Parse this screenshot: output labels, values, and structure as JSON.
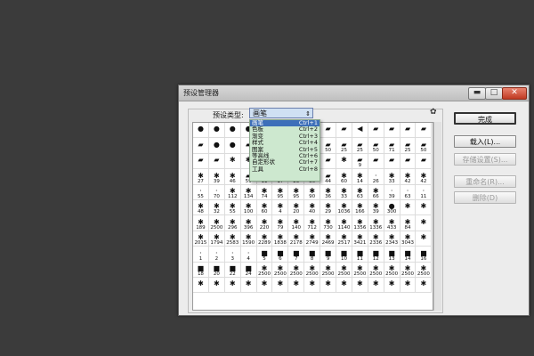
{
  "window": {
    "title": "预设管理器",
    "min": "▬",
    "max": "□",
    "close": "✕"
  },
  "preset_type_label": "预设类型:",
  "preset_type_value": "画笔",
  "dropdown_arrow": "⇕",
  "settings_icon": "gear-icon",
  "menu": [
    {
      "label": "画笔",
      "shortcut": "Ctrl+1"
    },
    {
      "label": "色板",
      "shortcut": "Ctrl+2"
    },
    {
      "label": "渐变",
      "shortcut": "Ctrl+3"
    },
    {
      "label": "样式",
      "shortcut": "Ctrl+4"
    },
    {
      "label": "图案",
      "shortcut": "Ctrl+5"
    },
    {
      "label": "等高线",
      "shortcut": "Ctrl+6"
    },
    {
      "label": "自定形状",
      "shortcut": "Ctrl+7"
    },
    {
      "label": "工具",
      "shortcut": "Ctrl+8"
    }
  ],
  "buttons": {
    "done": "完成",
    "load": "载入(L)...",
    "save": "存储设置(S)...",
    "rename": "重命名(R)...",
    "delete": "删除(D)"
  },
  "brush_rows": [
    [
      {
        "n": "",
        "g": "●"
      },
      {
        "n": "",
        "g": "●"
      },
      {
        "n": "",
        "g": "●"
      },
      {
        "n": "",
        "g": "●"
      },
      {
        "n": "",
        "g": "▰"
      },
      {
        "n": "",
        "g": "▰"
      },
      {
        "n": "",
        "g": "▰"
      },
      {
        "n": "",
        "g": "▰"
      },
      {
        "n": "",
        "g": "▰"
      },
      {
        "n": "",
        "g": "▰"
      },
      {
        "n": "",
        "g": "◀"
      },
      {
        "n": "",
        "g": "▰"
      },
      {
        "n": "",
        "g": "▰"
      },
      {
        "n": "",
        "g": "▰"
      },
      {
        "n": "",
        "g": "▰"
      }
    ],
    [
      {
        "n": "",
        "g": "▰"
      },
      {
        "n": "",
        "g": "●"
      },
      {
        "n": "",
        "g": "●"
      },
      {
        "n": "",
        "g": "▰"
      },
      {
        "n": "",
        "g": "▰"
      },
      {
        "n": "",
        "g": "▰"
      },
      {
        "n": "",
        "g": "▰"
      },
      {
        "n": "25",
        "g": "▰"
      },
      {
        "n": "50",
        "g": "▰"
      },
      {
        "n": "25",
        "g": "▰"
      },
      {
        "n": "25",
        "g": "▰"
      },
      {
        "n": "50",
        "g": "▰"
      },
      {
        "n": "71",
        "g": "▰"
      },
      {
        "n": "25",
        "g": "▰"
      },
      {
        "n": "50",
        "g": "▰"
      }
    ],
    [
      {
        "n": "",
        "g": "▰"
      },
      {
        "n": "",
        "g": "▰"
      },
      {
        "n": "",
        "g": "✱"
      },
      {
        "n": "",
        "g": "✱"
      },
      {
        "n": "",
        "g": "▰"
      },
      {
        "n": "",
        "g": "▰"
      },
      {
        "n": "",
        "g": "▰"
      },
      {
        "n": "",
        "g": "✱"
      },
      {
        "n": "",
        "g": "▰"
      },
      {
        "n": "",
        "g": "✱"
      },
      {
        "n": "9",
        "g": "▰"
      },
      {
        "n": "",
        "g": "▰"
      },
      {
        "n": "",
        "g": "▰"
      },
      {
        "n": "",
        "g": "▰"
      },
      {
        "n": "",
        "g": "▰"
      }
    ],
    [
      {
        "n": "27",
        "g": "✱"
      },
      {
        "n": "39",
        "g": "✱"
      },
      {
        "n": "46",
        "g": "✱"
      },
      {
        "n": "59",
        "g": "▰"
      },
      {
        "n": "11",
        "g": "▰"
      },
      {
        "n": "17",
        "g": "▰"
      },
      {
        "n": "23",
        "g": "✱"
      },
      {
        "n": "36",
        "g": "▰"
      },
      {
        "n": "44",
        "g": "▰"
      },
      {
        "n": "60",
        "g": "✱"
      },
      {
        "n": "14",
        "g": "✱"
      },
      {
        "n": "26",
        "g": "·"
      },
      {
        "n": "33",
        "g": "✱"
      },
      {
        "n": "42",
        "g": "✱"
      },
      {
        "n": "42",
        "g": "✱"
      }
    ],
    [
      {
        "n": "55",
        "g": "·"
      },
      {
        "n": "70",
        "g": "·"
      },
      {
        "n": "112",
        "g": "✱"
      },
      {
        "n": "134",
        "g": "✱"
      },
      {
        "n": "74",
        "g": "✱"
      },
      {
        "n": "95",
        "g": "✱"
      },
      {
        "n": "95",
        "g": "✱"
      },
      {
        "n": "90",
        "g": "✱"
      },
      {
        "n": "36",
        "g": "✱"
      },
      {
        "n": "33",
        "g": "✱"
      },
      {
        "n": "63",
        "g": "✱"
      },
      {
        "n": "66",
        "g": "✱"
      },
      {
        "n": "39",
        "g": "·"
      },
      {
        "n": "63",
        "g": "·"
      },
      {
        "n": "11",
        "g": "·"
      }
    ],
    [
      {
        "n": "48",
        "g": "✱"
      },
      {
        "n": "32",
        "g": "✱"
      },
      {
        "n": "55",
        "g": "✱"
      },
      {
        "n": "100",
        "g": "✱"
      },
      {
        "n": "60",
        "g": "✱"
      },
      {
        "n": "4",
        "g": "✱"
      },
      {
        "n": "20",
        "g": "✱"
      },
      {
        "n": "40",
        "g": "✱"
      },
      {
        "n": "29",
        "g": "✱"
      },
      {
        "n": "1036",
        "g": "✱"
      },
      {
        "n": "166",
        "g": "✱"
      },
      {
        "n": "39",
        "g": "✱"
      },
      {
        "n": "300",
        "g": "●"
      },
      {
        "n": "",
        "g": "✱"
      },
      {
        "n": "",
        "g": "✱"
      }
    ],
    [
      {
        "n": "189",
        "g": "✱"
      },
      {
        "n": "2500",
        "g": "✱"
      },
      {
        "n": "296",
        "g": "✱"
      },
      {
        "n": "396",
        "g": "✱"
      },
      {
        "n": "220",
        "g": "✱"
      },
      {
        "n": "79",
        "g": "✱"
      },
      {
        "n": "140",
        "g": "✱"
      },
      {
        "n": "712",
        "g": "✱"
      },
      {
        "n": "730",
        "g": "✱"
      },
      {
        "n": "1140",
        "g": "✱"
      },
      {
        "n": "1356",
        "g": "✱"
      },
      {
        "n": "1336",
        "g": "✱"
      },
      {
        "n": "433",
        "g": "✱"
      },
      {
        "n": "84",
        "g": "✱"
      },
      {
        "n": "",
        "g": "✱"
      }
    ],
    [
      {
        "n": "2015",
        "g": "✱"
      },
      {
        "n": "1794",
        "g": "✱"
      },
      {
        "n": "2583",
        "g": "✱"
      },
      {
        "n": "1590",
        "g": "✱"
      },
      {
        "n": "2289",
        "g": "✱"
      },
      {
        "n": "1838",
        "g": "✱"
      },
      {
        "n": "2178",
        "g": "✱"
      },
      {
        "n": "2749",
        "g": "✱"
      },
      {
        "n": "2469",
        "g": "✱"
      },
      {
        "n": "2517",
        "g": "✱"
      },
      {
        "n": "3421",
        "g": "✱"
      },
      {
        "n": "2336",
        "g": "✱"
      },
      {
        "n": "2343",
        "g": "✱"
      },
      {
        "n": "3043",
        "g": "✱"
      },
      {
        "n": "",
        "g": "✱"
      }
    ],
    [
      {
        "n": "1",
        "g": "·"
      },
      {
        "n": "2",
        "g": "·"
      },
      {
        "n": "3",
        "g": "·"
      },
      {
        "n": "4",
        "g": "·"
      },
      {
        "n": "5",
        "g": "■"
      },
      {
        "n": "6",
        "g": "■"
      },
      {
        "n": "7",
        "g": "■"
      },
      {
        "n": "8",
        "g": "■"
      },
      {
        "n": "9",
        "g": "■"
      },
      {
        "n": "10",
        "g": "■"
      },
      {
        "n": "11",
        "g": "■"
      },
      {
        "n": "12",
        "g": "■"
      },
      {
        "n": "13",
        "g": "■"
      },
      {
        "n": "14",
        "g": "■"
      },
      {
        "n": "16",
        "g": "■"
      }
    ],
    [
      {
        "n": "18",
        "g": "■"
      },
      {
        "n": "20",
        "g": "■"
      },
      {
        "n": "22",
        "g": "■"
      },
      {
        "n": "24",
        "g": "■"
      },
      {
        "n": "2500",
        "g": "✱"
      },
      {
        "n": "2500",
        "g": "✱"
      },
      {
        "n": "2500",
        "g": "✱"
      },
      {
        "n": "2500",
        "g": "✱"
      },
      {
        "n": "2500",
        "g": "✱"
      },
      {
        "n": "2500",
        "g": "✱"
      },
      {
        "n": "2500",
        "g": "✱"
      },
      {
        "n": "2500",
        "g": "✱"
      },
      {
        "n": "2500",
        "g": "✱"
      },
      {
        "n": "2500",
        "g": "✱"
      },
      {
        "n": "2500",
        "g": "✱"
      }
    ],
    [
      {
        "n": "",
        "g": "✱"
      },
      {
        "n": "",
        "g": "✱"
      },
      {
        "n": "",
        "g": "✱"
      },
      {
        "n": "",
        "g": "✱"
      },
      {
        "n": "",
        "g": "✱"
      },
      {
        "n": "",
        "g": "✱"
      },
      {
        "n": "",
        "g": "✱"
      },
      {
        "n": "",
        "g": "✱"
      },
      {
        "n": "",
        "g": "✱"
      },
      {
        "n": "",
        "g": "✱"
      },
      {
        "n": "",
        "g": "✱"
      },
      {
        "n": "",
        "g": "✱"
      },
      {
        "n": "",
        "g": "✱"
      },
      {
        "n": "",
        "g": "✱"
      },
      {
        "n": "",
        "g": "✱"
      }
    ]
  ]
}
